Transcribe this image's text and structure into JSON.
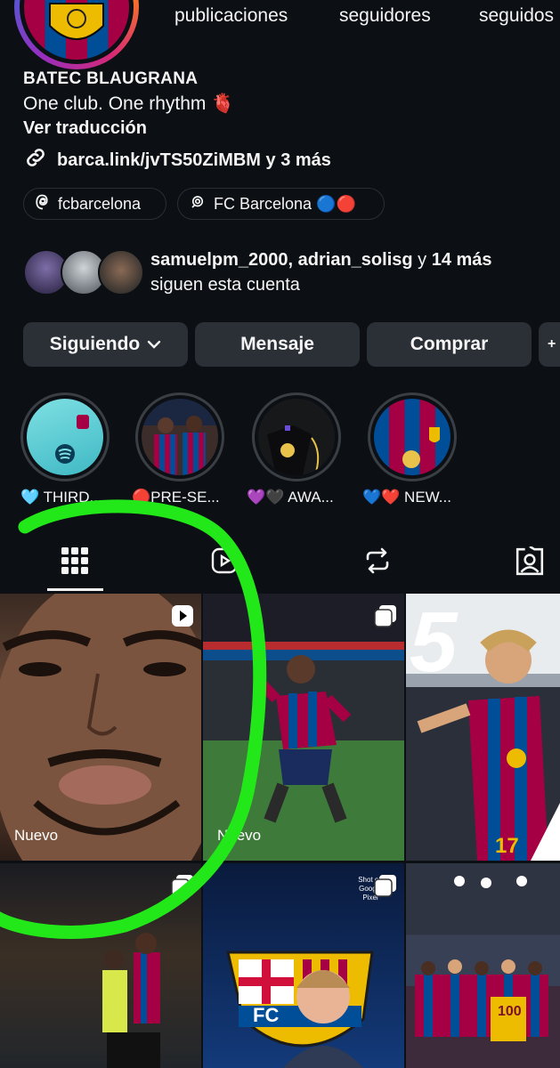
{
  "profile": {
    "stats": [
      {
        "number": "",
        "label": "publicaciones"
      },
      {
        "number": "",
        "label": "seguidores"
      },
      {
        "number": "",
        "label": "seguidos"
      }
    ],
    "name": "BATEC BLAUGRANA",
    "bio": "One club. One rhythm 🫀",
    "translate": "Ver traducción",
    "link": "barca.link/jvTS50ZiMBM y 3 más",
    "threads_handle": "fcbarcelona",
    "channel": "FC Barcelona 🔵🔴"
  },
  "followed_by": {
    "names": "samuelpm_2000, adrian_solisg",
    "connector": " y ",
    "more": "14 más",
    "line2": "siguen esta cuenta"
  },
  "actions": {
    "following": "Siguiendo",
    "message": "Mensaje",
    "shop": "Comprar"
  },
  "highlights": [
    {
      "label": "🩵 THIRD..."
    },
    {
      "label": "🔴PRE-SE..."
    },
    {
      "label": "💜🖤 AWA..."
    },
    {
      "label": "💙❤️ NEW..."
    }
  ],
  "grid": {
    "posts": [
      {
        "label": "Nuevo",
        "type": "video"
      },
      {
        "label": "Nuevo",
        "type": "carousel"
      },
      {
        "label": "",
        "type": "post"
      },
      {
        "label": "",
        "type": "carousel"
      },
      {
        "label": "",
        "type": "carousel"
      },
      {
        "label": "",
        "type": "post"
      }
    ],
    "overlay_text": {
      "big_number": "5",
      "shirt_number": "17",
      "crest_text": "FC",
      "pixel_tag": "Shot on Google Pixel",
      "shirt_100": "100"
    }
  },
  "colors": {
    "background": "#0c1014",
    "button": "#2b3036",
    "barca_blue": "#004d98",
    "barca_red": "#a50044",
    "annotation_green": "#22e81a"
  }
}
